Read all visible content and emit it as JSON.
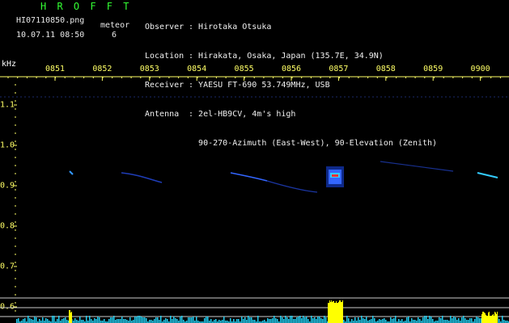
{
  "header": {
    "brand": "H R O F F T",
    "filename": "HI07110850.png",
    "timestamp": "10.07.11 08:50",
    "meteor_label": "meteor",
    "meteor_count": "6"
  },
  "station": {
    "observer_label": "Observer",
    "observer": "Hirotaka Otsuka",
    "location_label": "Location",
    "location": "Hirakata, Osaka, Japan (135.7E, 34.9N)",
    "receiver_label": "Receiver",
    "receiver": "YAESU FT-690 53.749MHz, USB",
    "antenna_label": "Antenna",
    "antenna": "2el-HB9CV, 4m's high",
    "antenna_detail": "90-270-Azimuth (East-West), 90-Elevation (Zenith)"
  },
  "axis": {
    "unit": "kHz",
    "time_labels": [
      "0851",
      "0852",
      "0853",
      "0854",
      "0855",
      "0856",
      "0857",
      "0858",
      "0859",
      "0900"
    ],
    "freq_labels": [
      "1.1",
      "1.0",
      "0.9",
      "0.8",
      "0.7",
      "0.6"
    ]
  },
  "colors": {
    "tick": "#ffff66",
    "accent_green": "#33ff33",
    "echo_cyan": "#33ccff",
    "level_yellow": "#ffff00"
  }
}
